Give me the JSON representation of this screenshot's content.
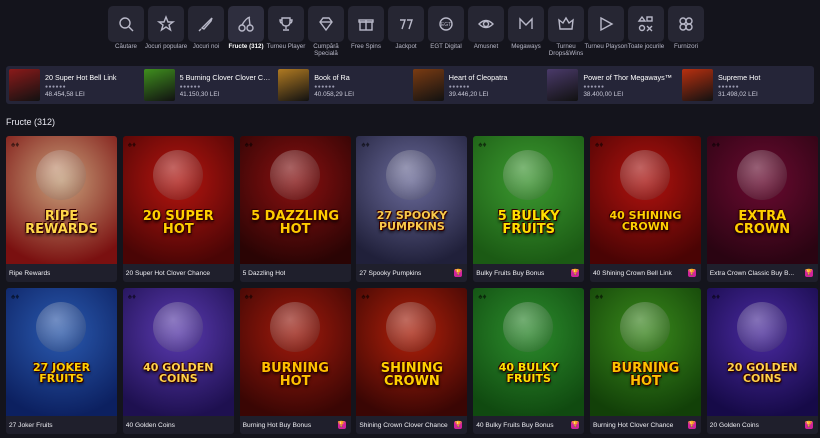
{
  "categories": [
    {
      "label": "Căutare",
      "icon": "search-icon",
      "active": false
    },
    {
      "label": "Jocuri populare",
      "icon": "star-icon",
      "active": false
    },
    {
      "label": "Jocuri noi",
      "icon": "rocket-icon",
      "active": false
    },
    {
      "label": "Fructe (312)",
      "icon": "cherry-icon",
      "active": true
    },
    {
      "label": "Turneu Player",
      "icon": "trophy-icon",
      "active": false
    },
    {
      "label": "Cumpără Specială",
      "icon": "diamond-icon",
      "active": false
    },
    {
      "label": "Free Spins",
      "icon": "gift-icon",
      "active": false
    },
    {
      "label": "Jackpot",
      "icon": "sevens-icon",
      "active": false
    },
    {
      "label": "EGT Digital",
      "icon": "egt-logo-icon",
      "active": false
    },
    {
      "label": "Amusnet",
      "icon": "amusnet-eye-icon",
      "active": false
    },
    {
      "label": "Megaways",
      "icon": "megaways-m-icon",
      "active": false
    },
    {
      "label": "Turneu Drops&Wins",
      "icon": "crown-icon",
      "active": false
    },
    {
      "label": "Turneu Playson",
      "icon": "playson-icon",
      "active": false
    },
    {
      "label": "Toate jocurile",
      "icon": "shapes-icon",
      "active": false
    },
    {
      "label": "Furnizori",
      "icon": "providers-icon",
      "active": false
    }
  ],
  "jackpots": [
    {
      "name": "20 Super Hot Bell Link",
      "stars": "●●●●●●",
      "amount": "48.454,58 LEI",
      "color": "#8b1a1a"
    },
    {
      "name": "5 Burning Clover Clover Ch...",
      "stars": "●●●●●●",
      "amount": "41.150,30 LEI",
      "color": "#3f8f1e"
    },
    {
      "name": "Book of Ra",
      "stars": "●●●●●●",
      "amount": "40.058,29 LEI",
      "color": "#b07a22"
    },
    {
      "name": "Heart of Cleopatra",
      "stars": "●●●●●●",
      "amount": "39.446,20 LEI",
      "color": "#7a3b12"
    },
    {
      "name": "Power of Thor Megaways™",
      "stars": "●●●●●●",
      "amount": "38.400,00 LEI",
      "color": "#4a3a6a"
    },
    {
      "name": "Supreme Hot",
      "stars": "●●●●●●",
      "amount": "31.498,02 LEI",
      "color": "#b83010"
    }
  ],
  "section_title": "Fructe (312)",
  "games": [
    {
      "name": "Ripe Rewards",
      "art": "RIPE REWARDS",
      "bg": "#c9a07a",
      "bg2": "#7a1010",
      "fg": "#ffd84a",
      "badge": false
    },
    {
      "name": "20 Super Hot Clover Chance",
      "art": "20 SUPER HOT",
      "bg": "#b5150f",
      "bg2": "#4a0505",
      "fg": "#ffd000",
      "badge": false
    },
    {
      "name": "5 Dazzling Hot",
      "art": "5 DAZZLING HOT",
      "bg": "#8a1010",
      "bg2": "#2a0404",
      "fg": "#ffcc00",
      "badge": false
    },
    {
      "name": "27 Spooky Pumpkins",
      "art": "27 SPOOKY PUMPKINS",
      "bg": "#6a6a9a",
      "bg2": "#20203a",
      "fg": "#f7c94a",
      "badge": true
    },
    {
      "name": "Bulky Fruits Buy Bonus",
      "art": "5 BULKY FRUITS",
      "bg": "#3c9a30",
      "bg2": "#1b5a14",
      "fg": "#ffe000",
      "badge": true
    },
    {
      "name": "40 Shining Crown Bell Link",
      "art": "40 SHINING CROWN",
      "bg": "#b0120e",
      "bg2": "#4a0404",
      "fg": "#ffd000",
      "badge": true
    },
    {
      "name": "Extra Crown Classic Buy B...",
      "art": "EXTRA CROWN",
      "bg": "#6a0a30",
      "bg2": "#2a0412",
      "fg": "#ffd000",
      "badge": true
    },
    {
      "name": "27 Joker Fruits",
      "art": "27 JOKER FRUITS",
      "bg": "#2a5ab0",
      "bg2": "#0c2060",
      "fg": "#ffd000",
      "badge": false
    },
    {
      "name": "40 Golden Coins",
      "art": "40 GOLDEN COINS",
      "bg": "#5a3ab0",
      "bg2": "#1e1050",
      "fg": "#ffd24a",
      "badge": false
    },
    {
      "name": "Burning Hot Buy Bonus",
      "art": "BURNING HOT",
      "bg": "#a01a0c",
      "bg2": "#3a0604",
      "fg": "#ffc000",
      "badge": true
    },
    {
      "name": "Shining Crown Clover Chance",
      "art": "SHINING CROWN",
      "bg": "#b0200a",
      "bg2": "#3a0604",
      "fg": "#ffd000",
      "badge": true
    },
    {
      "name": "40 Bulky Fruits Buy Bonus",
      "art": "40 BULKY FRUITS",
      "bg": "#2c8c2c",
      "bg2": "#104a10",
      "fg": "#ffe000",
      "badge": true
    },
    {
      "name": "Burning Hot Clover Chance",
      "art": "BURNING HOT",
      "bg": "#3a8a1c",
      "bg2": "#124008",
      "fg": "#ffc000",
      "badge": true
    },
    {
      "name": "20 Golden Coins",
      "art": "20 GOLDEN COINS",
      "bg": "#4a2aa0",
      "bg2": "#160a48",
      "fg": "#ffd24a",
      "badge": true
    }
  ]
}
